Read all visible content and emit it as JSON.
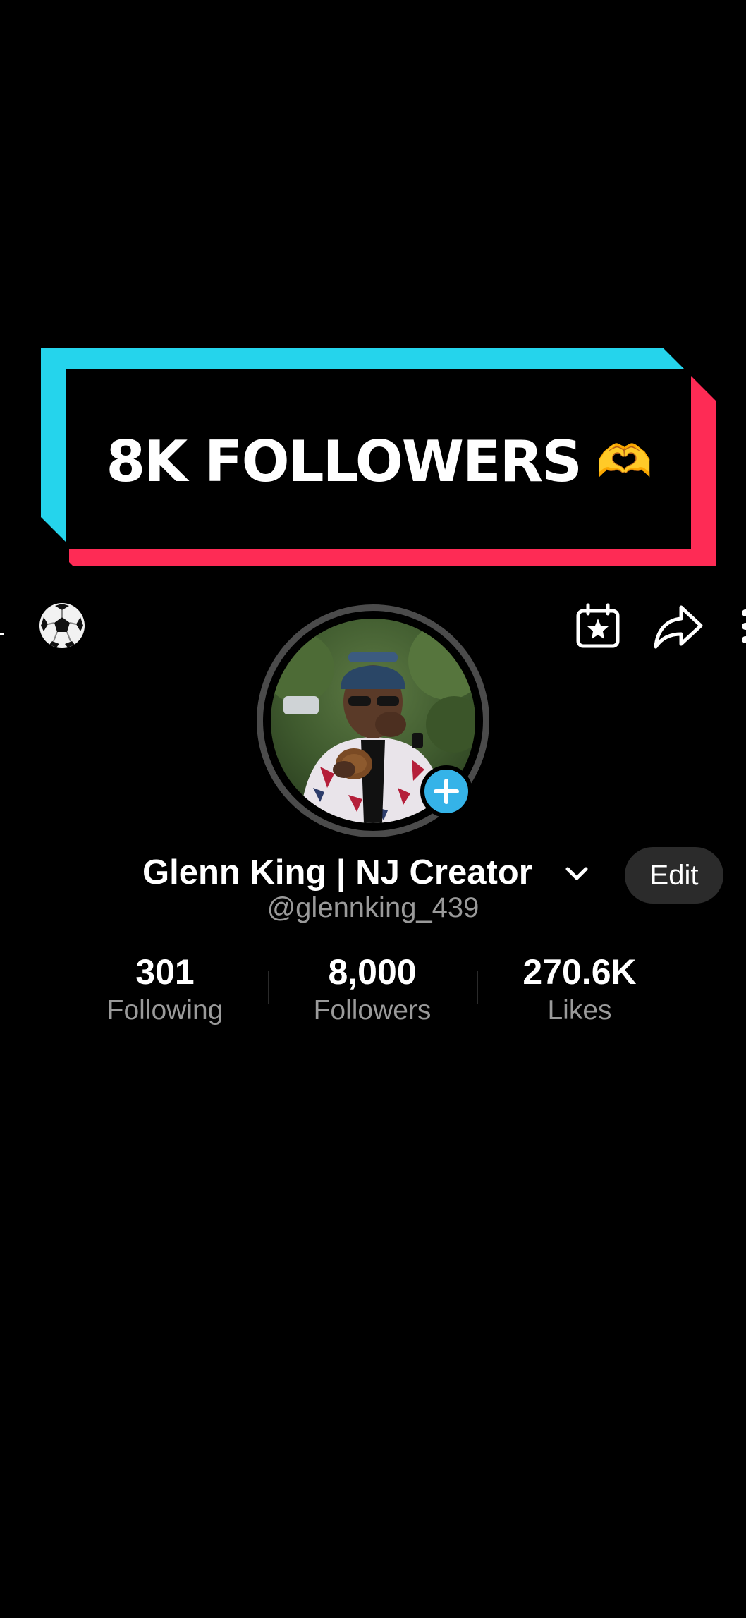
{
  "banner": {
    "text": "8K FOLLOWERS",
    "emoji": "🫶",
    "colors": {
      "cyan": "#25d4ec",
      "pink": "#fe2b55"
    }
  },
  "actions": {
    "left_icon": "soccer-ball-icon",
    "right_icons": [
      "calendar-star-icon",
      "share-arrow-icon",
      "more-vertical-icon"
    ]
  },
  "profile": {
    "display_name": "Glenn King | NJ Creator",
    "username": "@glennking_439",
    "edit_label": "Edit",
    "add_badge_color": "#35b3e8"
  },
  "stats": [
    {
      "value": "301",
      "label": "Following"
    },
    {
      "value": "8,000",
      "label": "Followers"
    },
    {
      "value": "270.6K",
      "label": "Likes"
    }
  ]
}
